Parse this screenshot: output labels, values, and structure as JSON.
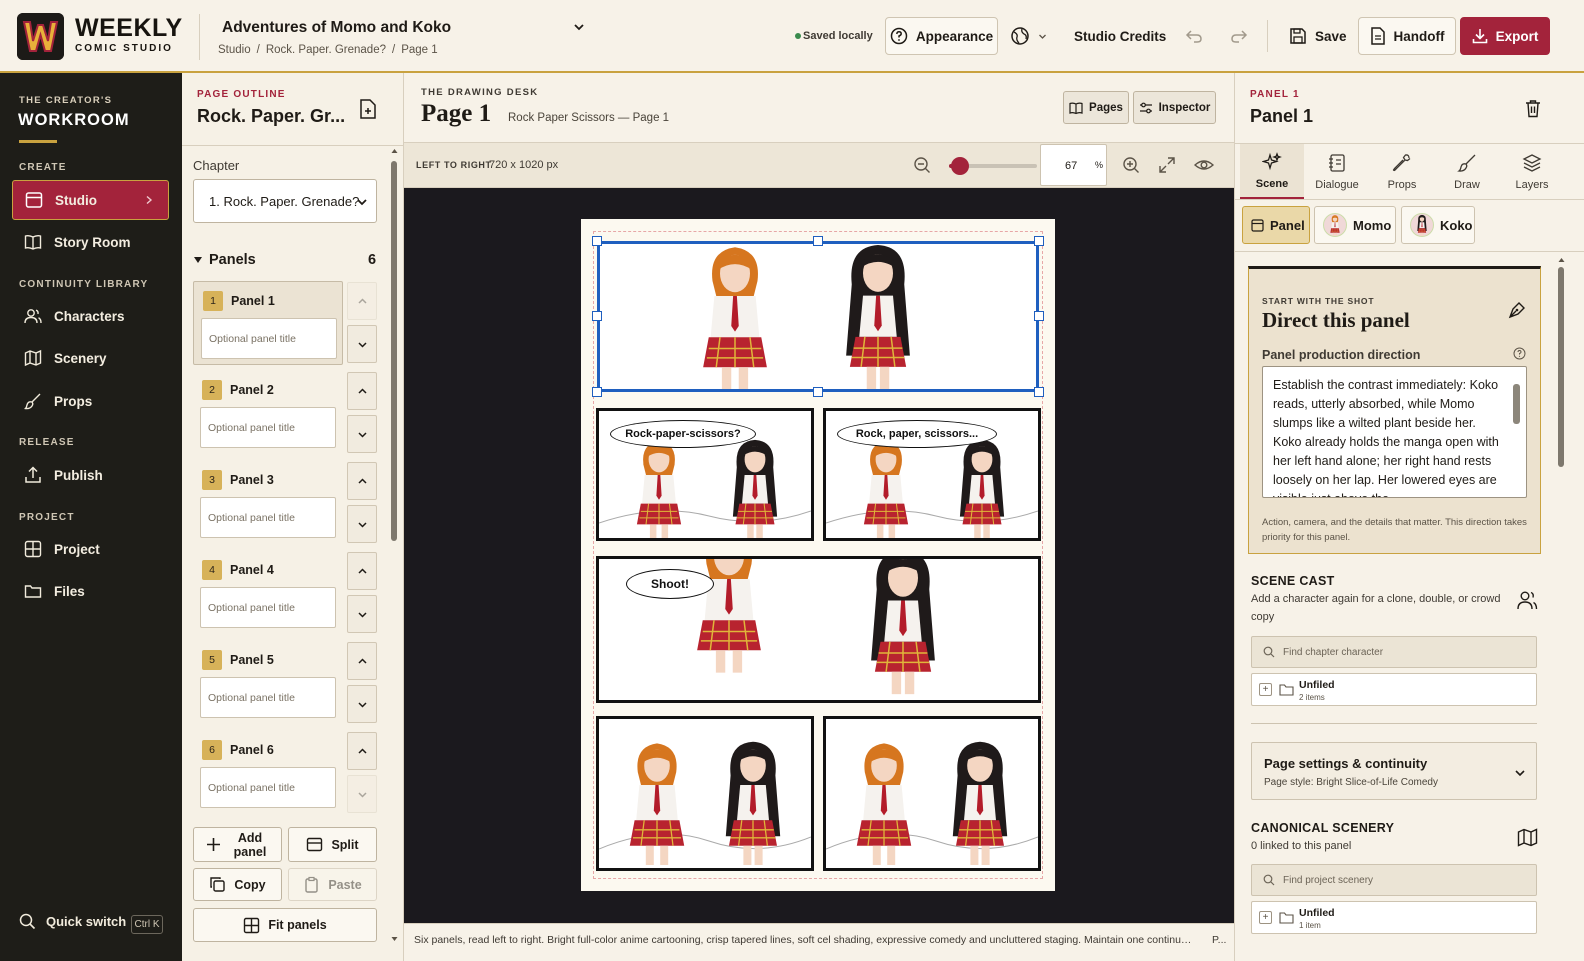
{
  "brand": {
    "title": "WEEKLY",
    "subtitle": "COMIC STUDIO"
  },
  "project": {
    "title": "Adventures of Momo and Koko",
    "breadcrumbs": [
      "Studio",
      "/",
      "Rock. Paper. Grenade?",
      "/",
      "Page 1"
    ]
  },
  "topbar": {
    "saved": "Saved locally",
    "appearance": "Appearance",
    "credits": "Studio Credits",
    "save": "Save",
    "handoff": "Handoff",
    "export": "Export"
  },
  "nav": {
    "kicker": "THE CREATOR'S",
    "title": "WORKROOM",
    "sections": {
      "create": "CREATE",
      "library": "CONTINUITY LIBRARY",
      "release": "RELEASE",
      "project": "PROJECT"
    },
    "items": {
      "studio": "Studio",
      "story_room": "Story Room",
      "characters": "Characters",
      "scenery": "Scenery",
      "props": "Props",
      "publish": "Publish",
      "project": "Project",
      "files": "Files"
    },
    "quick_switch": "Quick switch",
    "shortcut": "Ctrl K"
  },
  "outline": {
    "kicker": "PAGE OUTLINE",
    "title": "Rock. Paper. Gr...",
    "chapter_label": "Chapter",
    "chapter_value": "1. Rock. Paper. Grenade?",
    "panels_label": "Panels",
    "panels_count": "6",
    "panels": [
      {
        "num": "1",
        "name": "Panel 1",
        "placeholder": "Optional panel title"
      },
      {
        "num": "2",
        "name": "Panel 2",
        "placeholder": "Optional panel title"
      },
      {
        "num": "3",
        "name": "Panel 3",
        "placeholder": "Optional panel title"
      },
      {
        "num": "4",
        "name": "Panel 4",
        "placeholder": "Optional panel title"
      },
      {
        "num": "5",
        "name": "Panel 5",
        "placeholder": "Optional panel title"
      },
      {
        "num": "6",
        "name": "Panel 6",
        "placeholder": "Optional panel title"
      }
    ],
    "add_panel": "Add panel",
    "split": "Split",
    "copy": "Copy",
    "paste": "Paste",
    "fit_panels": "Fit panels"
  },
  "desk": {
    "kicker": "THE DRAWING DESK",
    "title": "Page 1",
    "subtitle": "Rock Paper Scissors — Page 1",
    "pages_btn": "Pages",
    "inspector_btn": "Inspector",
    "direction": "LEFT TO RIGHT",
    "size": "720 x 1020 px",
    "zoom": "67",
    "zoom_unit": "%",
    "zoom_fraction": 0.12,
    "bubbles": {
      "p2": "Rock-paper-scissors?",
      "p3": "Rock, paper, scissors...",
      "p4": "Shoot!"
    },
    "caption": "Six panels, read left to right. Bright full-color anime cartooning, crisp tapered lines, soft cel shading, expressive comedy and uncluttered staging. Maintain one continuous daytime...",
    "caption_more": "P..."
  },
  "inspector": {
    "kicker": "PANEL 1",
    "title": "Panel 1",
    "tabs": [
      "Scene",
      "Dialogue",
      "Props",
      "Draw",
      "Layers"
    ],
    "chips": [
      "Panel",
      "Momo",
      "Koko"
    ],
    "direct": {
      "kicker": "START WITH THE SHOT",
      "title": "Direct this panel",
      "label": "Panel production direction",
      "text": "Establish the contrast immediately: Koko reads, utterly absorbed, while Momo slumps like a wilted plant beside her. Koko already holds the manga open with her left hand alone; her right hand rests loosely on her lap. Her lowered eyes are visible just above the",
      "help": "Action, camera, and the details that matter. This direction takes priority for this panel."
    },
    "cast": {
      "title": "SCENE CAST",
      "sub": "Add a character again for a clone, double, or crowd copy",
      "search": "Find chapter character",
      "folder": "Unfiled",
      "count": "2 items"
    },
    "page_settings": {
      "title": "Page settings & continuity",
      "sub": "Page style: Bright Slice-of-Life Comedy"
    },
    "scenery": {
      "title": "CANONICAL SCENERY",
      "sub": "0 linked to this panel",
      "search": "Find project scenery",
      "folder": "Unfiled",
      "count": "1 item"
    }
  },
  "colors": {
    "accent": "#a3233b",
    "gold": "#c9a23f",
    "nav_bg": "#1e1d18",
    "canvas_bg": "#1b191e",
    "selection": "#1f5fbf"
  }
}
